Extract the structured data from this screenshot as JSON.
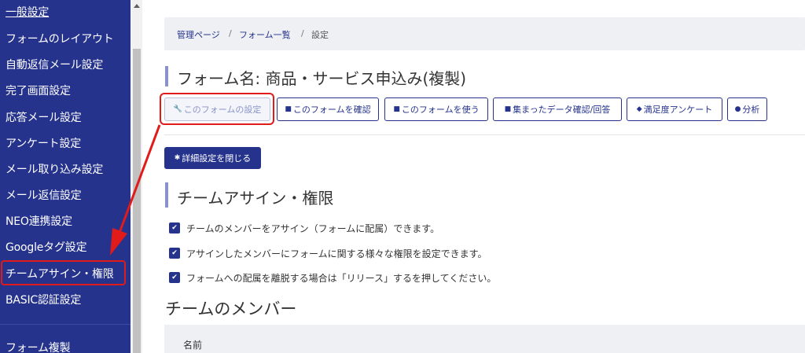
{
  "sidebar": {
    "items": [
      {
        "label": "一般設定"
      },
      {
        "label": "フォームのレイアウト"
      },
      {
        "label": "自動返信メール設定"
      },
      {
        "label": "完了画面設定"
      },
      {
        "label": "応答メール設定"
      },
      {
        "label": "アンケート設定"
      },
      {
        "label": "メール取り込み設定"
      },
      {
        "label": "メール返信設定"
      },
      {
        "label": "NEO連携設定"
      },
      {
        "label": "Googleタグ設定"
      },
      {
        "label": "チームアサイン・権限"
      },
      {
        "label": "BASIC認証設定"
      },
      {
        "label": "フォーム複製"
      }
    ],
    "active_index": 10
  },
  "breadcrumb": {
    "home": "管理ページ",
    "sep": "/",
    "list": "フォーム一覧",
    "current": "設定"
  },
  "form": {
    "title": "フォーム名: 商品・サービス申込み(複製)"
  },
  "tabs": [
    {
      "label": "このフォームの設定",
      "icon": "wrench-icon",
      "active": true
    },
    {
      "label": "このフォームを確認",
      "icon": "file-icon",
      "active": false
    },
    {
      "label": "このフォームを使う",
      "icon": "file-text-icon",
      "active": false
    },
    {
      "label": "集まったデータ確認/回答",
      "icon": "message-icon",
      "active": false
    },
    {
      "label": "満足度アンケート",
      "icon": "layers-icon",
      "active": false
    },
    {
      "label": "分析",
      "icon": "chart-icon",
      "active": false
    }
  ],
  "detail_button": {
    "label": "詳細設定を閉じる",
    "icon": "gear-icon"
  },
  "section": {
    "title": "チームアサイン・権限",
    "checks": [
      {
        "text": "チームのメンバーをアサイン（フォームに配属）できます。",
        "checked": true
      },
      {
        "text": "アサインしたメンバーにフォームに関する様々な権限を設定できます。",
        "checked": true
      },
      {
        "text": "フォームへの配属を離脱する場合は「リリース」するを押してください。",
        "checked": true
      }
    ]
  },
  "members": {
    "title": "チームのメンバー",
    "columns": [
      "名前"
    ]
  },
  "colors": {
    "primary": "#25338d",
    "highlight": "#e11a1a"
  }
}
